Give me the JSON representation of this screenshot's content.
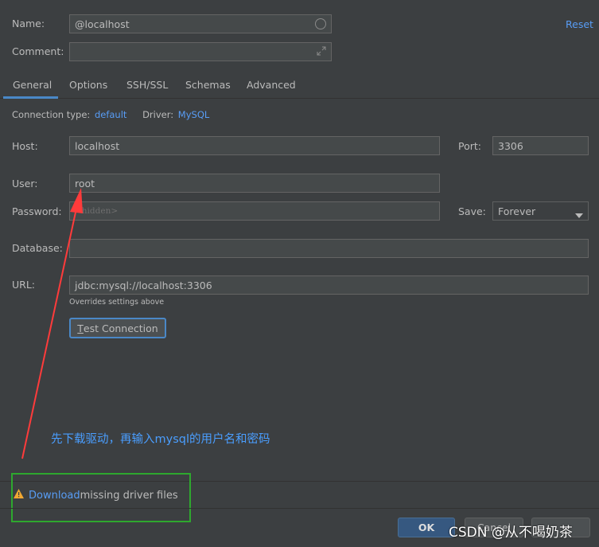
{
  "header": {
    "name_label": "Name:",
    "name_value": "@localhost",
    "comment_label": "Comment:",
    "comment_value": "",
    "reset_label": "Reset"
  },
  "tabs": [
    {
      "label": "General"
    },
    {
      "label": "Options"
    },
    {
      "label": "SSH/SSL"
    },
    {
      "label": "Schemas"
    },
    {
      "label": "Advanced"
    }
  ],
  "connection": {
    "type_label": "Connection type:",
    "type_value": "default",
    "driver_label": "Driver:",
    "driver_value": "MySQL"
  },
  "form": {
    "host_label": "Host:",
    "host_value": "localhost",
    "port_label": "Port:",
    "port_value": "3306",
    "user_label": "User:",
    "user_value": "root",
    "password_label": "Password:",
    "password_placeholder": "<hidden>",
    "save_label": "Save:",
    "save_value": "Forever",
    "database_label": "Database:",
    "database_value": "",
    "url_label": "URL:",
    "url_value": "jdbc:mysql://localhost:3306",
    "url_hint": "Overrides settings above",
    "test_button_mnemonic": "T",
    "test_button_rest": "est Connection"
  },
  "annotation": {
    "text": "先下载驱动，再输入mysql的用户名和密码",
    "color": "#4a9eff",
    "arrow_color": "#ff3b3b",
    "box_color": "#2ea82e"
  },
  "footer": {
    "download_link": "Download",
    "missing_text": " missing driver files",
    "ok_label": "OK",
    "cancel_label": "Cancel",
    "watermark": "CSDN @从不喝奶茶"
  }
}
